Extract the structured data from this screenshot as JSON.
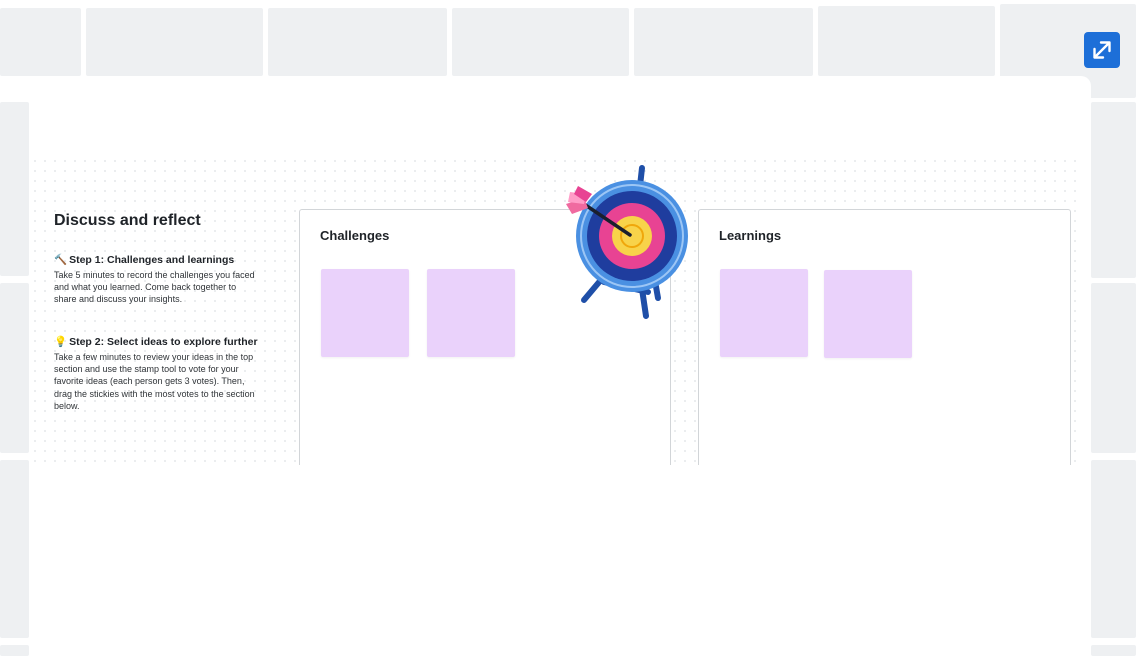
{
  "controls": {
    "expand_label": ""
  },
  "intro": {
    "title": "Discuss and reflect",
    "step1": {
      "icon": "hammer-icon",
      "title": "Step 1: Challenges and learnings",
      "body": "Take 5 minutes to record the challenges you faced and what you learned.  Come back together to share and discuss your insights."
    },
    "step2": {
      "icon": "lightbulb-icon",
      "title": "Step 2: Select ideas to explore further",
      "body": "Take a few minutes to review your ideas in the top section and use the stamp tool to vote for your favorite ideas (each person gets 3 votes). Then, drag the stickies with the most votes to the section below."
    }
  },
  "sections": {
    "challenges": {
      "title": "Challenges",
      "sticky_count": 2
    },
    "learnings": {
      "title": "Learnings",
      "sticky_count": 2
    }
  },
  "colors": {
    "accent": "#1d6fd8",
    "sticky": "#ead2fb",
    "background_tile": "#eef0f2",
    "target_rings": [
      "#4a90e2",
      "#1f3d9e",
      "#e84393",
      "#f8d34a"
    ]
  }
}
